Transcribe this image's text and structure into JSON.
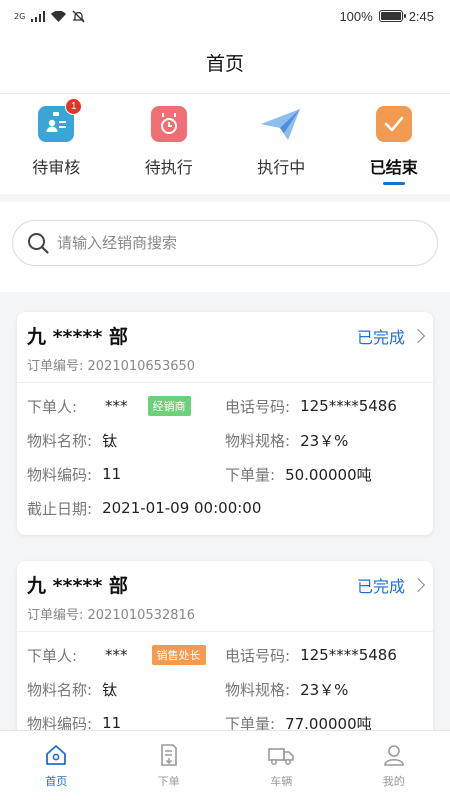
{
  "status_bar": {
    "network": "2G",
    "battery": "100%",
    "battery_level": 1.0,
    "time": "2:45"
  },
  "header": {
    "title": "首页"
  },
  "tabs": [
    {
      "label": "待审核",
      "icon": "reviewer-badge-icon",
      "badge": "1",
      "color": "#3aa6d6"
    },
    {
      "label": "待执行",
      "icon": "calendar-clock-icon",
      "color": "#ef6f75"
    },
    {
      "label": "执行中",
      "icon": "paper-plane-icon",
      "color": "#6aa7e0"
    },
    {
      "label": "已结束",
      "icon": "check-icon",
      "color": "#f39a52",
      "active": true
    }
  ],
  "search": {
    "placeholder": "请输入经销商搜索"
  },
  "labels": {
    "orderer": "下单人:",
    "phone": "电话号码:",
    "material_name": "物料名称:",
    "material_spec": "物料规格:",
    "material_code": "物料编码:",
    "quantity": "下单量:",
    "deadline": "截止日期:"
  },
  "orders": [
    {
      "title": "九 ***** 部",
      "order_no": "订单编号: 2021010653650",
      "status": "已完成",
      "orderer": "***",
      "role_tag": "经销商",
      "role_color": "#6dd17c",
      "phone": "125****5486",
      "material_name": "钛",
      "material_spec": "23￥%",
      "material_code": "11",
      "quantity": "50.00000吨",
      "deadline": "2021-01-09 00:00:00"
    },
    {
      "title": "九 ***** 部",
      "order_no": "订单编号: 2021010532816",
      "status": "已完成",
      "orderer": "***",
      "role_tag": "销售处长",
      "role_color": "#f59a4e",
      "phone": "125****5486",
      "material_name": "钛",
      "material_spec": "23￥%",
      "material_code": "11",
      "quantity": "77.00000吨"
    }
  ],
  "tab_bar": [
    {
      "label": "首页",
      "icon": "home-icon",
      "active": true
    },
    {
      "label": "下单",
      "icon": "order-form-icon"
    },
    {
      "label": "车辆",
      "icon": "truck-icon"
    },
    {
      "label": "我的",
      "icon": "user-profile-icon"
    }
  ],
  "colors": {
    "accent": "#1f6fd0",
    "badge": "#e5332a"
  }
}
